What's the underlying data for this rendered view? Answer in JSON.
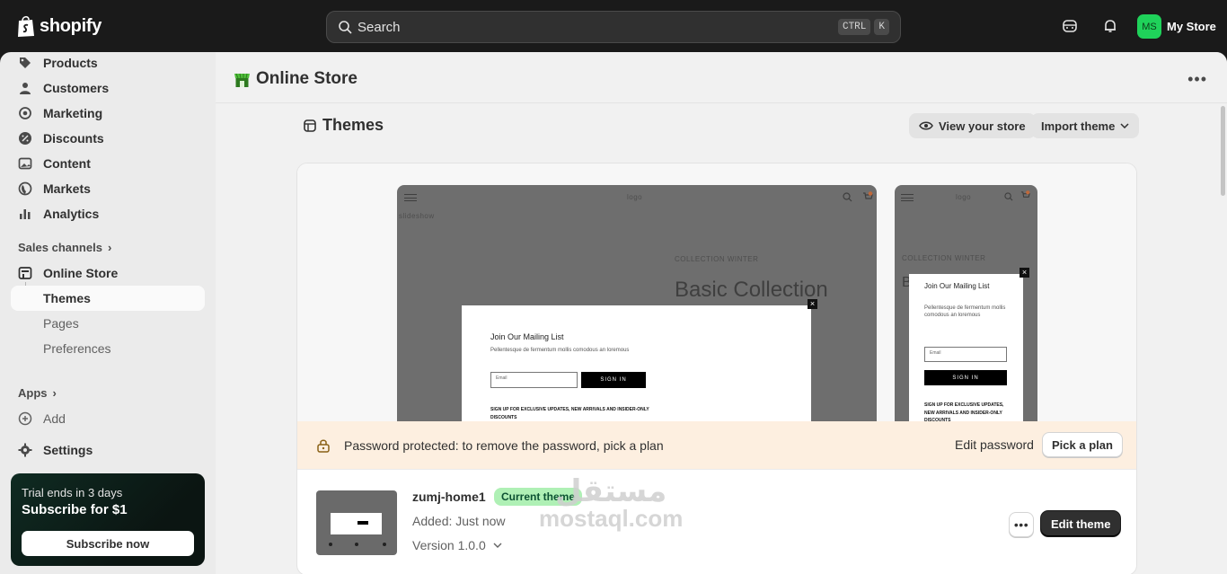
{
  "topbar": {
    "brand": "shopify",
    "search_placeholder": "Search",
    "shortcut_ctrl": "CTRL",
    "shortcut_key": "K",
    "store_initials": "MS",
    "store_name": "My Store"
  },
  "sidebar": {
    "items": [
      {
        "label": "Products",
        "icon": "tag-icon"
      },
      {
        "label": "Customers",
        "icon": "person-icon"
      },
      {
        "label": "Marketing",
        "icon": "target-icon"
      },
      {
        "label": "Discounts",
        "icon": "discount-icon"
      },
      {
        "label": "Content",
        "icon": "image-icon"
      },
      {
        "label": "Markets",
        "icon": "globe-icon"
      },
      {
        "label": "Analytics",
        "icon": "bar-chart-icon"
      }
    ],
    "sales_channels_label": "Sales channels",
    "online_store_label": "Online Store",
    "sub_items": [
      "Themes",
      "Pages",
      "Preferences"
    ],
    "apps_label": "Apps",
    "add_label": "Add",
    "settings_label": "Settings",
    "trial": {
      "line1": "Trial ends in 3 days",
      "line2": "Subscribe for $1",
      "button": "Subscribe now"
    }
  },
  "main": {
    "page_title": "Online Store",
    "section_title": "Themes",
    "view_store_label": "View your store",
    "import_theme_label": "Import theme",
    "preview": {
      "logo_text": "logo",
      "slideshow_text": "slideshow",
      "collection_label": "COLLECTION WINTER",
      "collection_title": "Basic Collection",
      "mobile_collection_title": "B",
      "modal_heading": "Join Our Mailing List",
      "modal_text": "Pellentesque de fermentum mollis comodous an loremous",
      "email_placeholder": "Email",
      "signin_label": "SIGN IN",
      "footer_text": "SIGN UP FOR EXCLUSIVE UPDATES, NEW ARRIVALS AND INSIDER-ONLY DISCOUNTS"
    },
    "password_banner": {
      "text": "Password protected: to remove the password, pick a plan",
      "edit_password": "Edit password",
      "pick_plan": "Pick a plan"
    },
    "theme": {
      "name": "zumj-home1",
      "badge": "Current theme",
      "added": "Added: Just now",
      "version": "Version 1.0.0",
      "edit_label": "Edit theme"
    }
  },
  "watermark": {
    "arabic": "مستقل",
    "latin": "mostaql.com"
  },
  "colors": {
    "topbar_bg": "#1a1a1a",
    "avatar_bg": "#1fd25a",
    "badge_bg": "#aff0b5",
    "banner_bg": "#fdefe0",
    "primary_button": "#303030"
  }
}
